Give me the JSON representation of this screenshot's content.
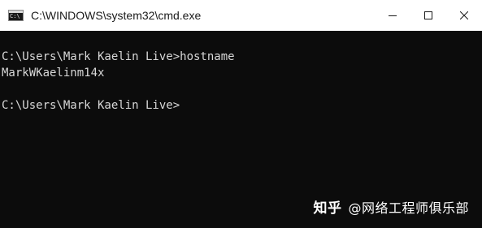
{
  "window": {
    "title": "C:\\WINDOWS\\system32\\cmd.exe",
    "icon_name": "cmd-icon",
    "icon_glyph": "C:\\"
  },
  "console": {
    "lines": [
      "C:\\Users\\Mark Kaelin Live>hostname",
      "MarkWKaelinm14x",
      "",
      "C:\\Users\\Mark Kaelin Live>"
    ]
  },
  "watermark": {
    "brand": "知乎",
    "handle": "@网络工程师俱乐部"
  }
}
